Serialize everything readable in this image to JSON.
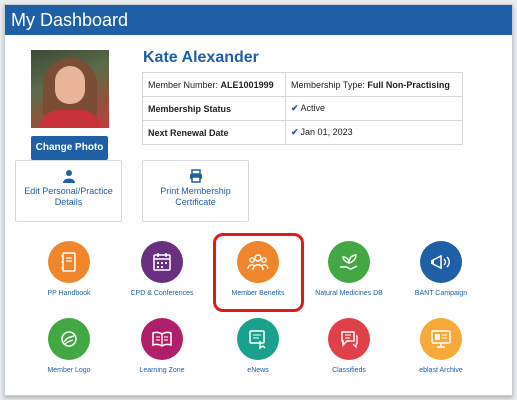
{
  "header": {
    "title": "My Dashboard"
  },
  "profile": {
    "name": "Kate Alexander",
    "change_photo_label": "Change Photo"
  },
  "info_table": {
    "member_number_label": "Member Number:",
    "member_number": "ALE1001999",
    "membership_type_label": "Membership Type:",
    "membership_type": "Full Non-Practising",
    "status_label": "Membership Status",
    "status_value": "Active",
    "renewal_label": "Next Renewal Date",
    "renewal_value": "Jan 01, 2023"
  },
  "actions": {
    "edit_details": "Edit Personal/Practice Details",
    "print_cert": "Print Membership Certificate"
  },
  "grid": {
    "pp_handbook": "PP Handbook",
    "cpd": "CPD & Conferences",
    "member_benefits": "Member Benefits",
    "natural_medicines": "Natural Medicines DB",
    "bant_campaign": "BANT Campaign",
    "member_logo": "Member Logo",
    "learning_zone": "Learning Zone",
    "enews": "eNews",
    "classifieds": "Classifieds",
    "eblast_archive": "eblast Archive"
  },
  "colors": {
    "brand_blue": "#1f5fa5",
    "highlight_red": "#e01a1a",
    "orange": "#f0862c",
    "purple": "#6a3080",
    "green": "#43a843",
    "navy": "#1f5fa5",
    "magenta": "#b0206a",
    "teal": "#1aa08c",
    "red": "#e0404a",
    "amber": "#f7a93a"
  }
}
